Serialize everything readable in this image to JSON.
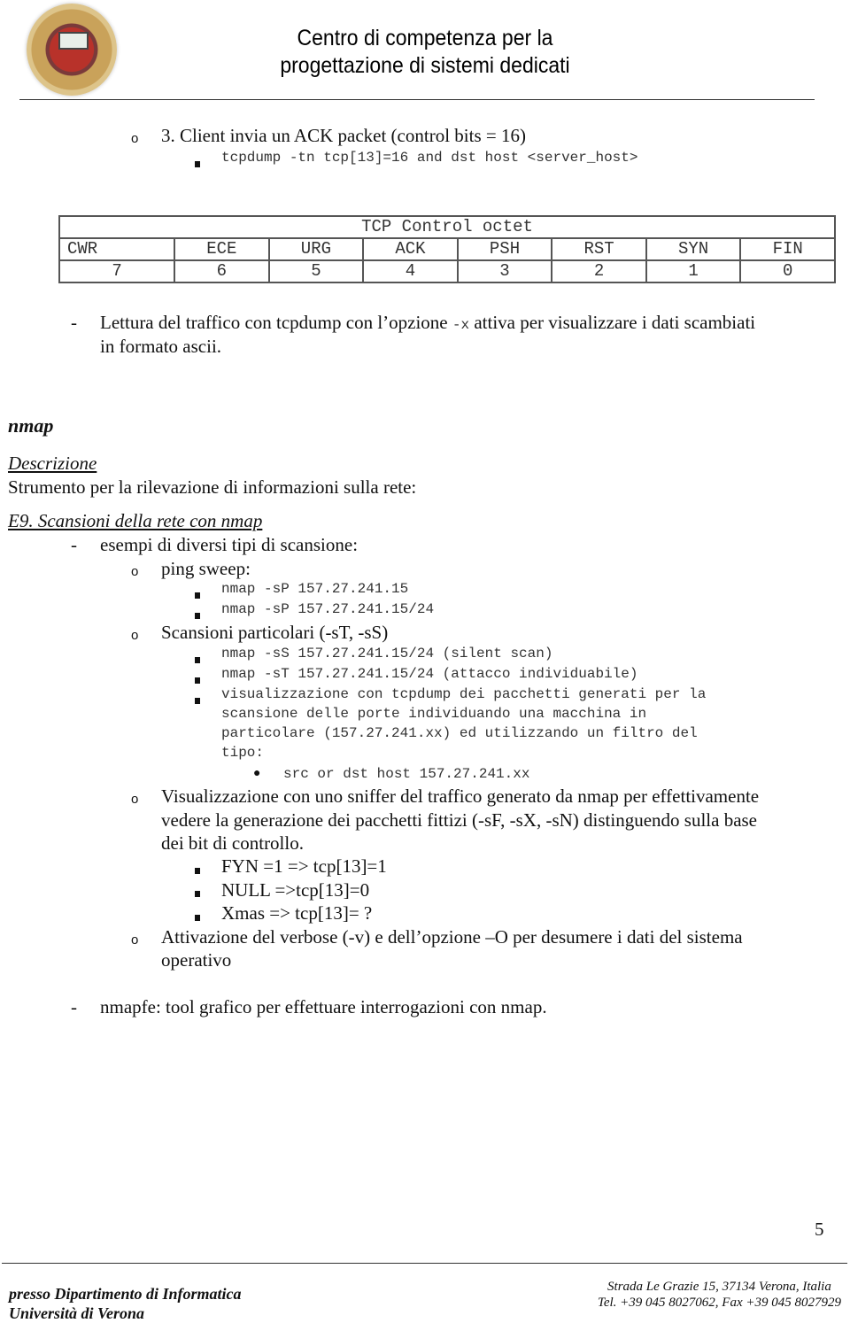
{
  "header": {
    "title_line1": "Centro di competenza per la",
    "title_line2": "progettazione di sistemi dedicati",
    "logo": "university-seal-logo"
  },
  "step3": {
    "bullet": "o",
    "text": "3. Client invia un ACK packet (control bits = 16)",
    "command": "tcpdump -tn tcp[13]=16 and dst host <server_host>"
  },
  "tcp_table": {
    "title": "TCP Control octet",
    "flags": [
      "CWR",
      "ECE",
      "URG",
      "ACK",
      "PSH",
      "RST",
      "SYN",
      "FIN"
    ],
    "bits": [
      "7",
      "6",
      "5",
      "4",
      "3",
      "2",
      "1",
      "0"
    ]
  },
  "lettura": {
    "bullet": "-",
    "text_before": "Lettura del traffico con tcpdump con l’opzione ",
    "option": "-x",
    "text_after": " attiva per visualizzare i dati scambiati",
    "line2": "in formato ascii."
  },
  "nmap_section": {
    "heading": "nmap",
    "desc_heading": "Descrizione",
    "desc_text": "Strumento per la rilevazione di informazioni sulla rete:",
    "exercise_heading": "E9. Scansioni della rete con nmap",
    "examples_intro": "esempi di diversi tipi di scansione:",
    "ping_sweep": {
      "label": "ping sweep:",
      "commands": [
        "nmap -sP 157.27.241.15",
        "nmap -sP 157.27.241.15/24"
      ]
    },
    "particular": {
      "label": "Scansioni particolari (-sT, -sS)",
      "commands": [
        "nmap -sS 157.27.241.15/24 (silent scan)",
        "nmap -sT 157.27.241.15/24 (attacco individuabile)"
      ],
      "visual_lines": [
        "visualizzazione con tcpdump dei pacchetti generati per la",
        "scansione delle porte individuando una macchina in",
        "particolare (157.27.241.xx) ed utilizzando un filtro del",
        "tipo:"
      ],
      "filter": "src or dst host 157.27.241.xx"
    },
    "sniffer": {
      "lines": [
        "Visualizzazione con uno sniffer del traffico generato da nmap per effettivamente",
        "vedere la generazione dei pacchetti fittizi (-sF, -sX, -sN) distinguendo sulla base",
        "dei bit di controllo."
      ],
      "items": [
        "FYN =1 => tcp[13]=1",
        "NULL =>tcp[13]=0",
        "Xmas => tcp[13]= ?"
      ]
    },
    "verbose": {
      "lines": [
        "Attivazione del verbose (-v) e dell’opzione –O per desumere i dati del sistema",
        "operativo"
      ]
    },
    "nmapfe": "nmapfe: tool grafico per effettuare interrogazioni con nmap."
  },
  "page_number": "5",
  "footer": {
    "left_line1": "presso Dipartimento di Informatica",
    "left_line2": "Università di Verona",
    "right_line1": "Strada Le Grazie 15, 37134 Verona, Italia",
    "right_line2": "Tel. +39 045 8027062, Fax +39 045 8027929"
  }
}
